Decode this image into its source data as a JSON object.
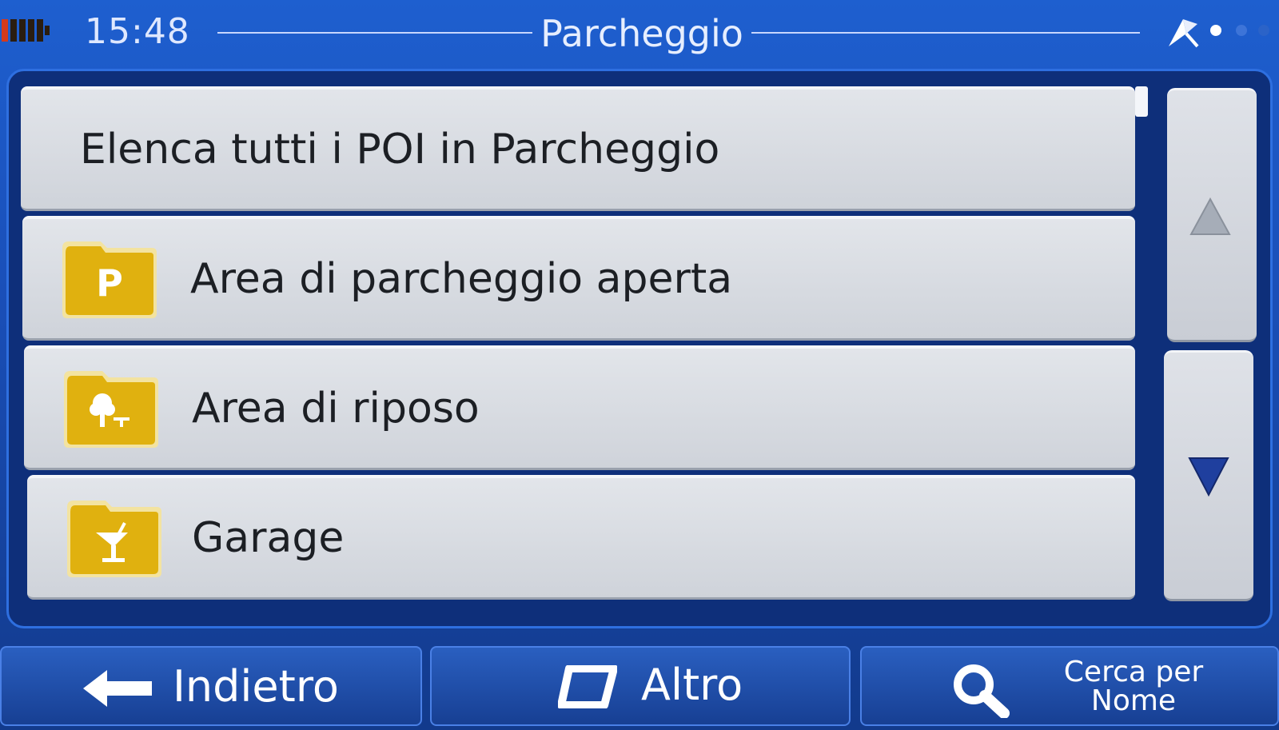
{
  "status_bar": {
    "time": "15:48",
    "title": "Parcheggio",
    "battery_icon": "battery-low-icon",
    "gps_icon": "satellite-icon"
  },
  "list": {
    "items": [
      {
        "label": "Elenca tutti i POI in Parcheggio",
        "icon": null
      },
      {
        "label": "Area di parcheggio aperta",
        "icon": "parking-folder-icon"
      },
      {
        "label": "Area di riposo",
        "icon": "rest-area-folder-icon"
      },
      {
        "label": "Garage",
        "icon": "garage-folder-icon"
      }
    ],
    "scroll_up_icon": "triangle-up-icon",
    "scroll_down_icon": "triangle-down-icon"
  },
  "bottom_bar": {
    "back_label": "Indietro",
    "more_label": "Altro",
    "search_label_line1": "Cerca per",
    "search_label_line2": "Nome"
  },
  "colors": {
    "background_blue": "#1a4fb8",
    "row_gray": "#d6d9df",
    "folder_yellow": "#e2b512",
    "scroll_down_blue": "#1f3f9e"
  }
}
